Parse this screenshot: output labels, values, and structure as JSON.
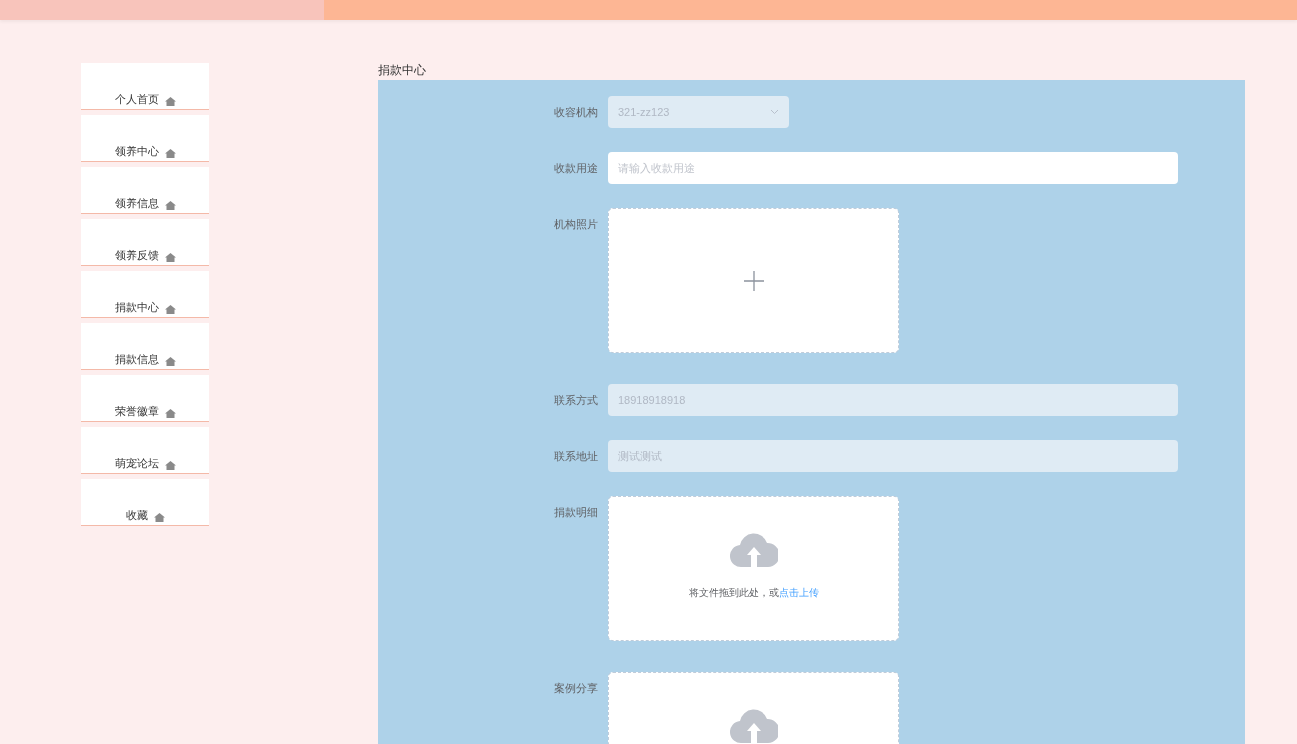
{
  "sidebar": {
    "items": [
      {
        "label": "个人首页"
      },
      {
        "label": "领养中心"
      },
      {
        "label": "领养信息"
      },
      {
        "label": "领养反馈"
      },
      {
        "label": "捐款中心"
      },
      {
        "label": "捐款信息"
      },
      {
        "label": "荣誉徽章"
      },
      {
        "label": "萌宠论坛"
      },
      {
        "label": "收藏"
      }
    ]
  },
  "page_title": "捐款中心",
  "form": {
    "fields": [
      {
        "kind": "select",
        "label": "收容机构",
        "value": "321-zz123",
        "disabled": true
      },
      {
        "kind": "input",
        "label": "收款用途",
        "placeholder": "请输入收款用途",
        "disabled": false
      },
      {
        "kind": "image",
        "label": "机构照片"
      },
      {
        "kind": "input",
        "label": "联系方式",
        "value": "18918918918",
        "disabled": true
      },
      {
        "kind": "input",
        "label": "联系地址",
        "value": "测试测试",
        "disabled": true
      },
      {
        "kind": "file",
        "label": "捐款明细",
        "hint": "将文件拖到此处，或",
        "link": "点击上传"
      },
      {
        "kind": "file",
        "label": "案例分享"
      }
    ]
  }
}
